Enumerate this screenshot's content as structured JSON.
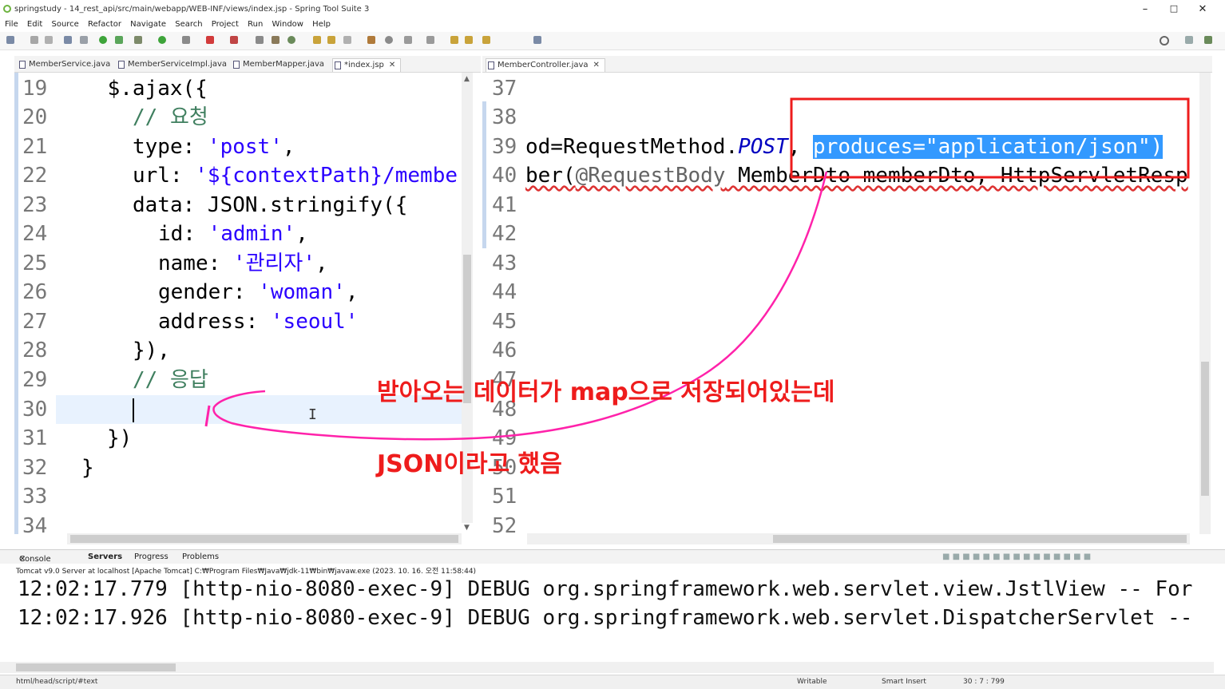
{
  "window": {
    "title": "springstudy - 14_rest_api/src/main/webapp/WEB-INF/views/index.jsp - Spring Tool Suite 3",
    "minimize": "–",
    "maximize": "□",
    "close": "✕"
  },
  "menu": [
    "File",
    "Edit",
    "Source",
    "Refactor",
    "Navigate",
    "Search",
    "Project",
    "Run",
    "Window",
    "Help"
  ],
  "left_editor": {
    "tabs": [
      {
        "label": "MemberService.java"
      },
      {
        "label": "MemberServiceImpl.java"
      },
      {
        "label": "MemberMapper.java"
      },
      {
        "label": "*index.jsp",
        "close": "✕"
      }
    ],
    "line_numbers": [
      "19",
      "20",
      "21",
      "22",
      "23",
      "24",
      "25",
      "26",
      "27",
      "28",
      "29",
      "30",
      "31",
      "32",
      "33",
      "34"
    ],
    "lines": {
      "l19": "    $.ajax({",
      "l20_c": "// 요청",
      "l21_k": "type: ",
      "l21_s": "'post'",
      "l21_e": ",",
      "l22_k": "url: ",
      "l22_s": "'${contextPath}/membe",
      "l23": "data: JSON.stringify({",
      "l24_k": "id: ",
      "l24_s": "'admin'",
      "l24_e": ",",
      "l25_k": "name: ",
      "l25_s": "'관리자'",
      "l25_e": ",",
      "l26_k": "gender: ",
      "l26_s": "'woman'",
      "l26_e": ",",
      "l27_k": "address: ",
      "l27_s": "'seoul'",
      "l28": "}),",
      "l29_c": "// 응답",
      "l31": "})",
      "l32": "}"
    }
  },
  "right_editor": {
    "tab": {
      "label": "MemberController.java",
      "close": "✕"
    },
    "line_numbers": [
      "37",
      "38",
      "39",
      "40",
      "41",
      "42",
      "43",
      "44",
      "45",
      "46",
      "47",
      "48",
      "49",
      "50",
      "51",
      "52"
    ],
    "line39_a": "od=RequestMethod.",
    "line39_b": "POST",
    "line39_c": ", ",
    "line39_sel": "produces=\"application/json\")",
    "line40_a": "ber(",
    "line40_b": "@RequestBody",
    "line40_c": " MemberDto memberDto, HttpServletResp"
  },
  "annotations": {
    "text1": "받아오는 데이터가 map으로 저장되어있는데",
    "text2": "JSON이라고 했음",
    "color": "#ee1c1c",
    "stroke": "#ff22aa"
  },
  "console": {
    "tabs": [
      {
        "label": "Console",
        "close": "✕"
      },
      {
        "label": "Servers"
      },
      {
        "label": "Progress"
      },
      {
        "label": "Problems"
      }
    ],
    "description": "Tomcat v9.0 Server at localhost [Apache Tomcat] C:₩Program Files₩Java₩jdk-11₩bin₩javaw.exe  (2023. 10. 16. 오전 11:58:44)",
    "lines": [
      "12:02:17.779 [http-nio-8080-exec-9] DEBUG org.springframework.web.servlet.view.JstlView -- For",
      "12:02:17.926 [http-nio-8080-exec-9] DEBUG org.springframework.web.servlet.DispatcherServlet --"
    ]
  },
  "status": {
    "path": "html/head/script/#text",
    "writable": "Writable",
    "insert": "Smart Insert",
    "position": "30 : 7 : 799"
  }
}
